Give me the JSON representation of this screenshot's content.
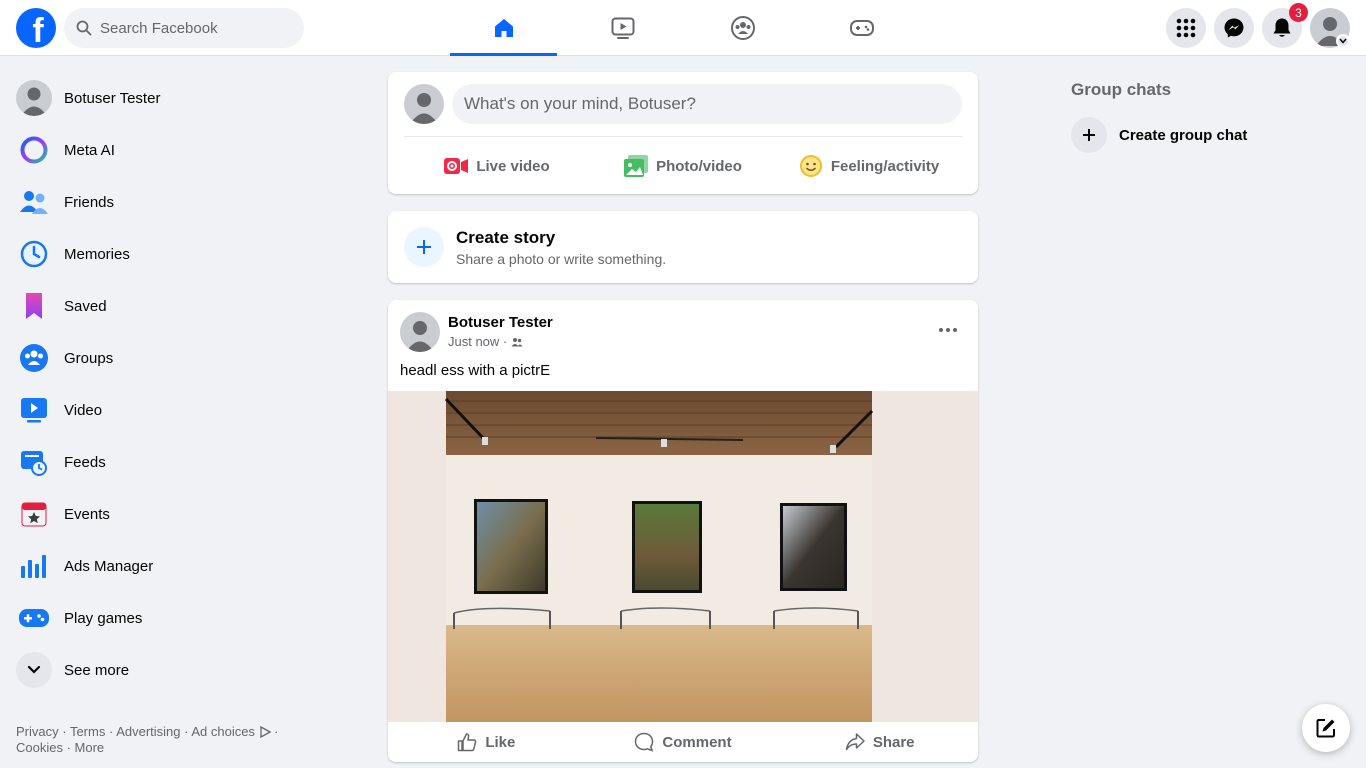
{
  "header": {
    "logo_letter": "f",
    "search_placeholder": "Search Facebook",
    "notifications_count": "3",
    "nav_tabs": [
      {
        "icon": "home-icon",
        "active": true
      },
      {
        "icon": "video-icon",
        "active": false
      },
      {
        "icon": "groups-icon",
        "active": false
      },
      {
        "icon": "gaming-icon",
        "active": false
      }
    ]
  },
  "sidebar": {
    "items": [
      {
        "label": "Botuser Tester",
        "icon": "profile-avatar"
      },
      {
        "label": "Meta AI",
        "icon": "meta-ai-icon"
      },
      {
        "label": "Friends",
        "icon": "friends-icon"
      },
      {
        "label": "Memories",
        "icon": "memories-icon"
      },
      {
        "label": "Saved",
        "icon": "saved-icon"
      },
      {
        "label": "Groups",
        "icon": "groups-icon"
      },
      {
        "label": "Video",
        "icon": "video-icon"
      },
      {
        "label": "Feeds",
        "icon": "feeds-icon"
      },
      {
        "label": "Events",
        "icon": "events-icon"
      },
      {
        "label": "Ads Manager",
        "icon": "ads-manager-icon"
      },
      {
        "label": "Play games",
        "icon": "gamepad-icon"
      },
      {
        "label": "See more",
        "icon": "chevron-down-icon"
      }
    ],
    "footer": {
      "privacy": "Privacy",
      "terms": "Terms",
      "advertising": "Advertising",
      "ad_choices": "Ad choices",
      "cookies": "Cookies",
      "more": "More"
    }
  },
  "composer": {
    "placeholder": "What's on your mind, Botuser?",
    "live_video": "Live video",
    "photo_video": "Photo/video",
    "feeling": "Feeling/activity"
  },
  "story": {
    "title": "Create story",
    "subtitle": "Share a photo or write something."
  },
  "post": {
    "author": "Botuser Tester",
    "time": "Just now",
    "text": "headl ess with a pictrE",
    "like": "Like",
    "comment": "Comment",
    "share": "Share"
  },
  "right": {
    "title": "Group chats",
    "create_group_chat": "Create group chat"
  },
  "colors": {
    "brand": "#0866ff",
    "badge": "#e41e3f",
    "background": "#f0f2f5"
  }
}
